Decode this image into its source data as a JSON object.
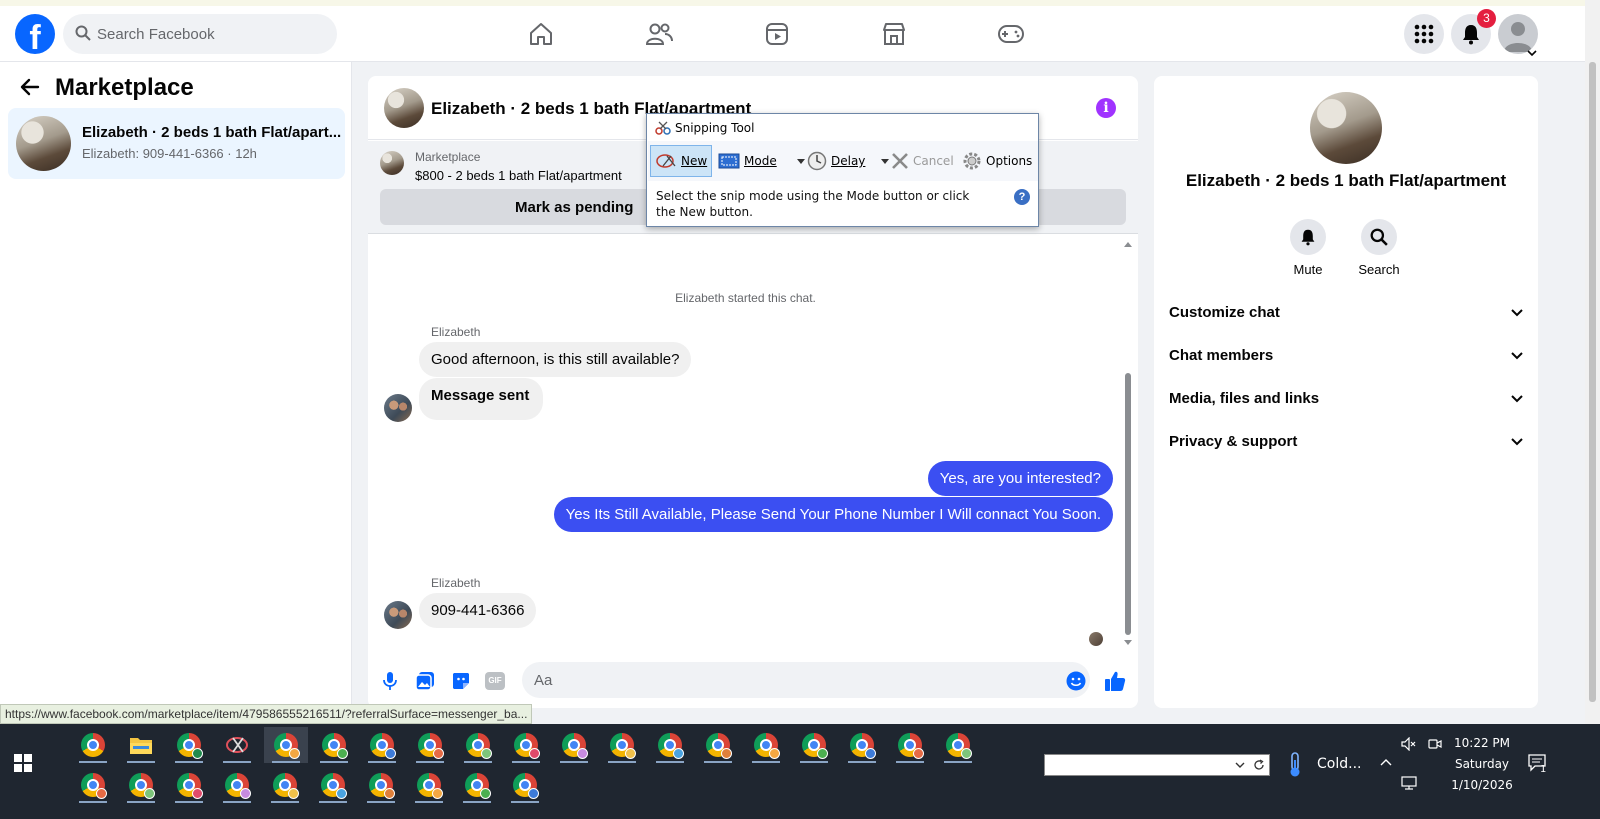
{
  "topbar": {
    "search_placeholder": "Search Facebook",
    "notification_count": "3",
    "brand_color": "#0866ff"
  },
  "left_panel": {
    "title": "Marketplace",
    "conversation": {
      "title": "Elizabeth · 2 beds 1 bath Flat/apart...",
      "subtitle": "Elizabeth: 909-441-6366 · 12h"
    }
  },
  "chat": {
    "title": "Elizabeth · 2 beds 1 bath Flat/apartment",
    "listing_label": "Marketplace",
    "listing_price": "$800 - 2 beds 1 bath Flat/apartment",
    "pending_button": "Mark as pending",
    "system_note": "Elizabeth started this chat.",
    "messages": [
      {
        "sender": "Elizabeth",
        "text": "Good afternoon, is this still available?",
        "direction": "in"
      },
      {
        "sender": "",
        "text": "Message sent",
        "direction": "in"
      },
      {
        "sender": "",
        "text": "Yes, are you interested?",
        "direction": "out"
      },
      {
        "sender": "",
        "text": "Yes Its Still Available, Please Send Your Phone Number I Will connact You Soon.",
        "direction": "out"
      },
      {
        "sender": "Elizabeth",
        "text": "909-441-6366",
        "direction": "in"
      }
    ],
    "composer_placeholder": "Aa",
    "gif_label": "GIF",
    "outgoing_color": "#3b4ff2"
  },
  "right_panel": {
    "title": "Elizabeth · 2 beds 1 bath Flat/apartment",
    "actions": [
      "Mute",
      "Search"
    ],
    "sections": [
      "Customize chat",
      "Chat members",
      "Media, files and links",
      "Privacy & support"
    ]
  },
  "status_url": "https://www.facebook.com/marketplace/item/479586555216511/?referralSurface=messenger_ba...",
  "snipping_tool": {
    "title": "Snipping Tool",
    "buttons": {
      "new": "New",
      "mode": "Mode",
      "delay": "Delay",
      "cancel": "Cancel",
      "options": "Options"
    },
    "message": "Select the snip mode using the Mode button or click the New button.",
    "help": "?"
  },
  "taskbar": {
    "weather": "Cold...",
    "time": "10:22 PM",
    "day": "Saturday",
    "date": "1/10/2026",
    "notification_count": "1"
  }
}
